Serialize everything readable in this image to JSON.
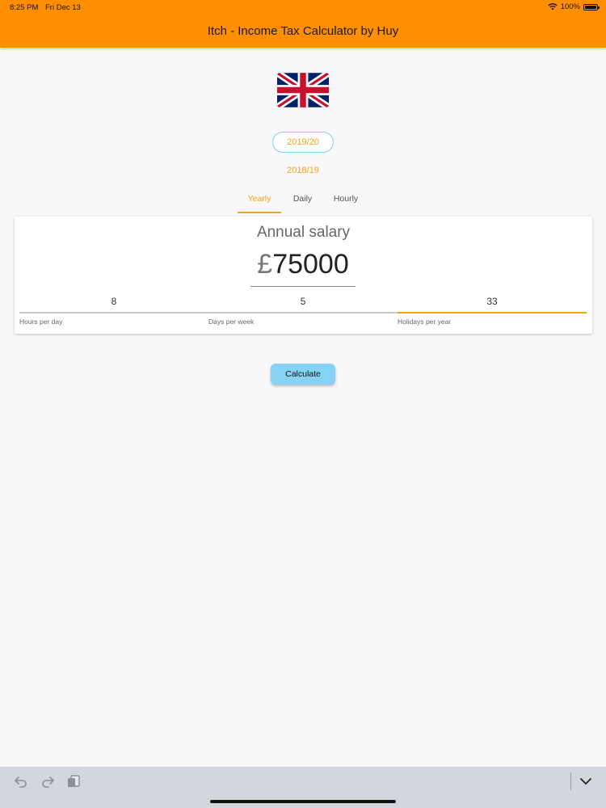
{
  "status_bar": {
    "time": "8:25 PM",
    "date": "Fri Dec 13",
    "battery": "100%"
  },
  "app": {
    "title": "Itch - Income Tax Calculator by Huy"
  },
  "flag_icon": "uk-flag-icon",
  "tax_years": {
    "selected": "2019/20",
    "other": "2018/19"
  },
  "tabs": [
    {
      "label": "Yearly",
      "active": true
    },
    {
      "label": "Daily",
      "active": false
    },
    {
      "label": "Hourly",
      "active": false
    }
  ],
  "salary": {
    "label": "Annual salary",
    "currency": "£",
    "value": "75000"
  },
  "fields": {
    "hours": {
      "value": "8",
      "label": "Hours per day"
    },
    "days": {
      "value": "5",
      "label": "Days per week"
    },
    "holidays": {
      "value": "33",
      "label": "Holidays per year"
    }
  },
  "actions": {
    "calculate": "Calculate"
  },
  "colors": {
    "appbar": "#ff8f00",
    "accent": "#f5a30f",
    "chip_border": "#7fd2ea",
    "button": "#85d2f5"
  },
  "keyboard_bar": {
    "icons": [
      "undo-icon",
      "redo-icon",
      "paste-icon",
      "chevron-down-icon"
    ]
  }
}
